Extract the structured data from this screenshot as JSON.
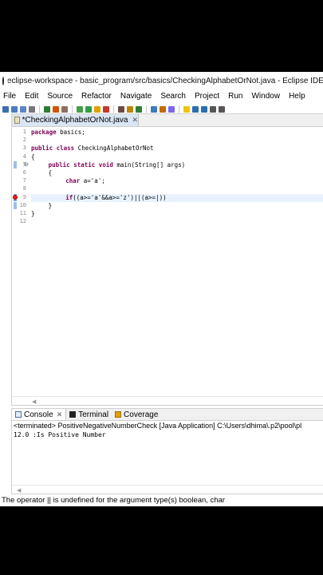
{
  "title": "eclipse-workspace - basic_program/src/basics/CheckingAlphabetOrNot.java - Eclipse IDE",
  "menu": [
    "File",
    "Edit",
    "Source",
    "Refactor",
    "Navigate",
    "Search",
    "Project",
    "Run",
    "Window",
    "Help"
  ],
  "toolbar_icons": [
    "new-icon",
    "save-icon",
    "save-all-icon",
    "print-icon",
    "sep",
    "console-icon",
    "git-icon",
    "build-icon",
    "sep",
    "debug-icon",
    "run-icon",
    "coverage-icon",
    "external-tools-icon",
    "sep",
    "new-java-project-icon",
    "new-package-icon",
    "new-class-icon",
    "sep",
    "open-type-icon",
    "search-icon",
    "task-icon",
    "sep",
    "annotation-icon",
    "next-annotation-icon",
    "prev-annotation-icon",
    "back-icon",
    "forward-icon"
  ],
  "toolbar_colors": [
    "#3b6fb6",
    "#4a7cc0",
    "#5b87c6",
    "#777777",
    "",
    "#2e7d32",
    "#d35400",
    "#8d6e63",
    "",
    "#43a047",
    "#2e9d44",
    "#e0a000",
    "#c0392b",
    "",
    "#6d4c41",
    "#b8860b",
    "#2e7d32",
    "",
    "#3e7bbf",
    "#c26b00",
    "#7b68ee",
    "",
    "#f1c40f",
    "#2a6fb0",
    "#2a6fb0",
    "#555555",
    "#555555"
  ],
  "editor": {
    "tab_label": "*CheckingAlphabetOrNot.java",
    "line_numbers": [
      "1",
      "2",
      "3",
      "4",
      "5",
      "6",
      "7",
      "8",
      "9",
      "10",
      "11",
      "12"
    ],
    "lines": [
      {
        "kw": "package",
        "text": " basics;"
      },
      {
        "kw": "",
        "text": ""
      },
      {
        "kw": "public class",
        "text": " CheckingAlphabetOrNot"
      },
      {
        "kw": "",
        "text": "{"
      },
      {
        "kw": "public static void",
        "text": " main(String[] args)"
      },
      {
        "kw": "",
        "text": "{"
      },
      {
        "kw": "char",
        "text": " a='a';"
      },
      {
        "kw": "",
        "text": ""
      },
      {
        "kw": "if",
        "text": "((a>='a'&&a>='z')||(a>=|))"
      },
      {
        "kw": "",
        "text": "}"
      },
      {
        "kw": "",
        "text": "}"
      },
      {
        "kw": "",
        "text": ""
      }
    ]
  },
  "console": {
    "tabs": [
      "Console",
      "Terminal",
      "Coverage"
    ],
    "header": "<terminated> PositiveNegativeNumberCheck [Java Application] C:\\Users\\dhima\\.p2\\pool\\pl",
    "output": "12.0 :Is Positive Number"
  },
  "status_message": "The operator || is undefined for the argument type(s) boolean, char",
  "colors": {
    "keyword": "#7f0055",
    "error": "#d22222",
    "current_line": "#e8f2fe",
    "tab_active": "#dbe6f4"
  }
}
